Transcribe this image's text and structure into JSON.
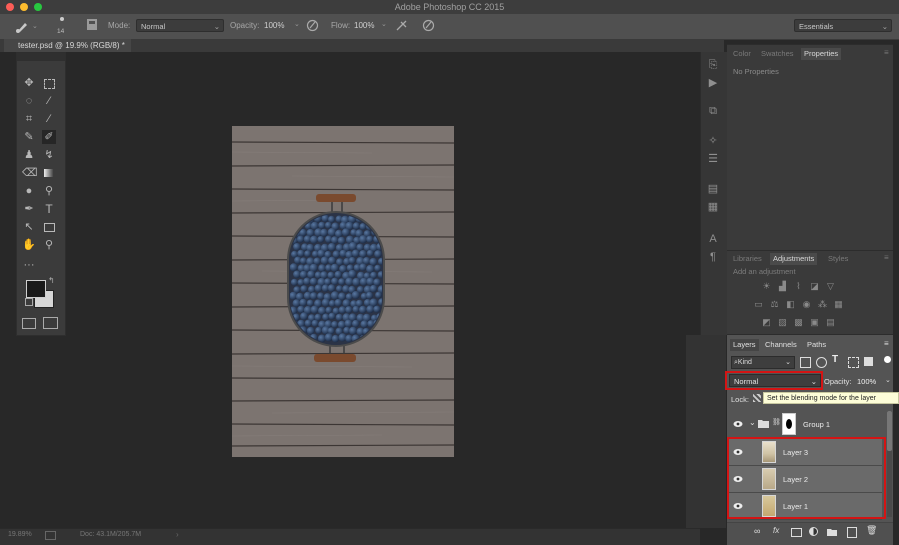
{
  "app": {
    "title": "Adobe Photoshop CC 2015"
  },
  "colors": {
    "close": "#fc5d57",
    "minimize": "#fdbc2e",
    "zoom": "#28c840",
    "highlight": "#d41414",
    "tooltip_bg": "#fdfdd8"
  },
  "options": {
    "brush_size": "14",
    "mode_label": "Mode:",
    "mode_value": "Normal",
    "opacity_label": "Opacity:",
    "opacity_value": "100%",
    "flow_label": "Flow:",
    "flow_value": "100%",
    "workspace": "Essentials"
  },
  "document": {
    "tab_label": "tester.psd @ 19.9% (RGB/8) *"
  },
  "status": {
    "zoom": "19.89%",
    "doc": "Doc: 43.1M/205.7M"
  },
  "properties_panel": {
    "tabs": [
      "Color",
      "Swatches",
      "Properties"
    ],
    "active_tab": "Properties",
    "empty_text": "No Properties"
  },
  "adjustments_panel": {
    "tabs": [
      "Libraries",
      "Adjustments",
      "Styles"
    ],
    "active_tab": "Adjustments",
    "hint": "Add an adjustment"
  },
  "layers_panel": {
    "tabs": [
      "Layers",
      "Channels",
      "Paths"
    ],
    "active_tab": "Layers",
    "filter_kind": "Kind",
    "blend_mode": "Normal",
    "opacity_label": "Opacity:",
    "opacity_value": "100%",
    "lock_label": "Lock:",
    "tooltip": "Set the blending mode for the layer",
    "group_name": "Group 1",
    "layers": [
      {
        "name": "Layer 3"
      },
      {
        "name": "Layer 2"
      },
      {
        "name": "Layer 1"
      }
    ]
  }
}
